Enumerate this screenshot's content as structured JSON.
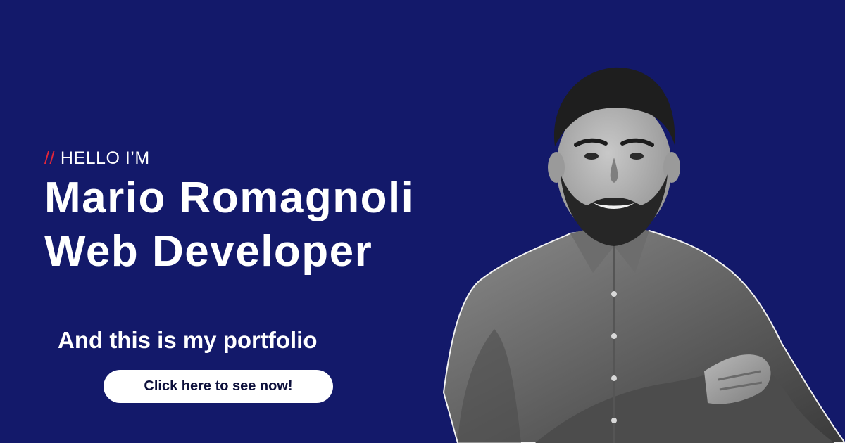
{
  "hero": {
    "greeting_prefix": "//",
    "greeting": "HELLO I’M",
    "name": "Mario Romagnoli",
    "role": "Web Developer",
    "tagline": "And this is my portfolio",
    "cta_label": "Click here to see now!"
  },
  "portrait": {
    "icon": "person-photo"
  },
  "colors": {
    "background": "#13196a",
    "accent": "#e3263a",
    "text": "#ffffff",
    "button_bg": "#ffffff",
    "button_text": "#0c0f3a"
  }
}
